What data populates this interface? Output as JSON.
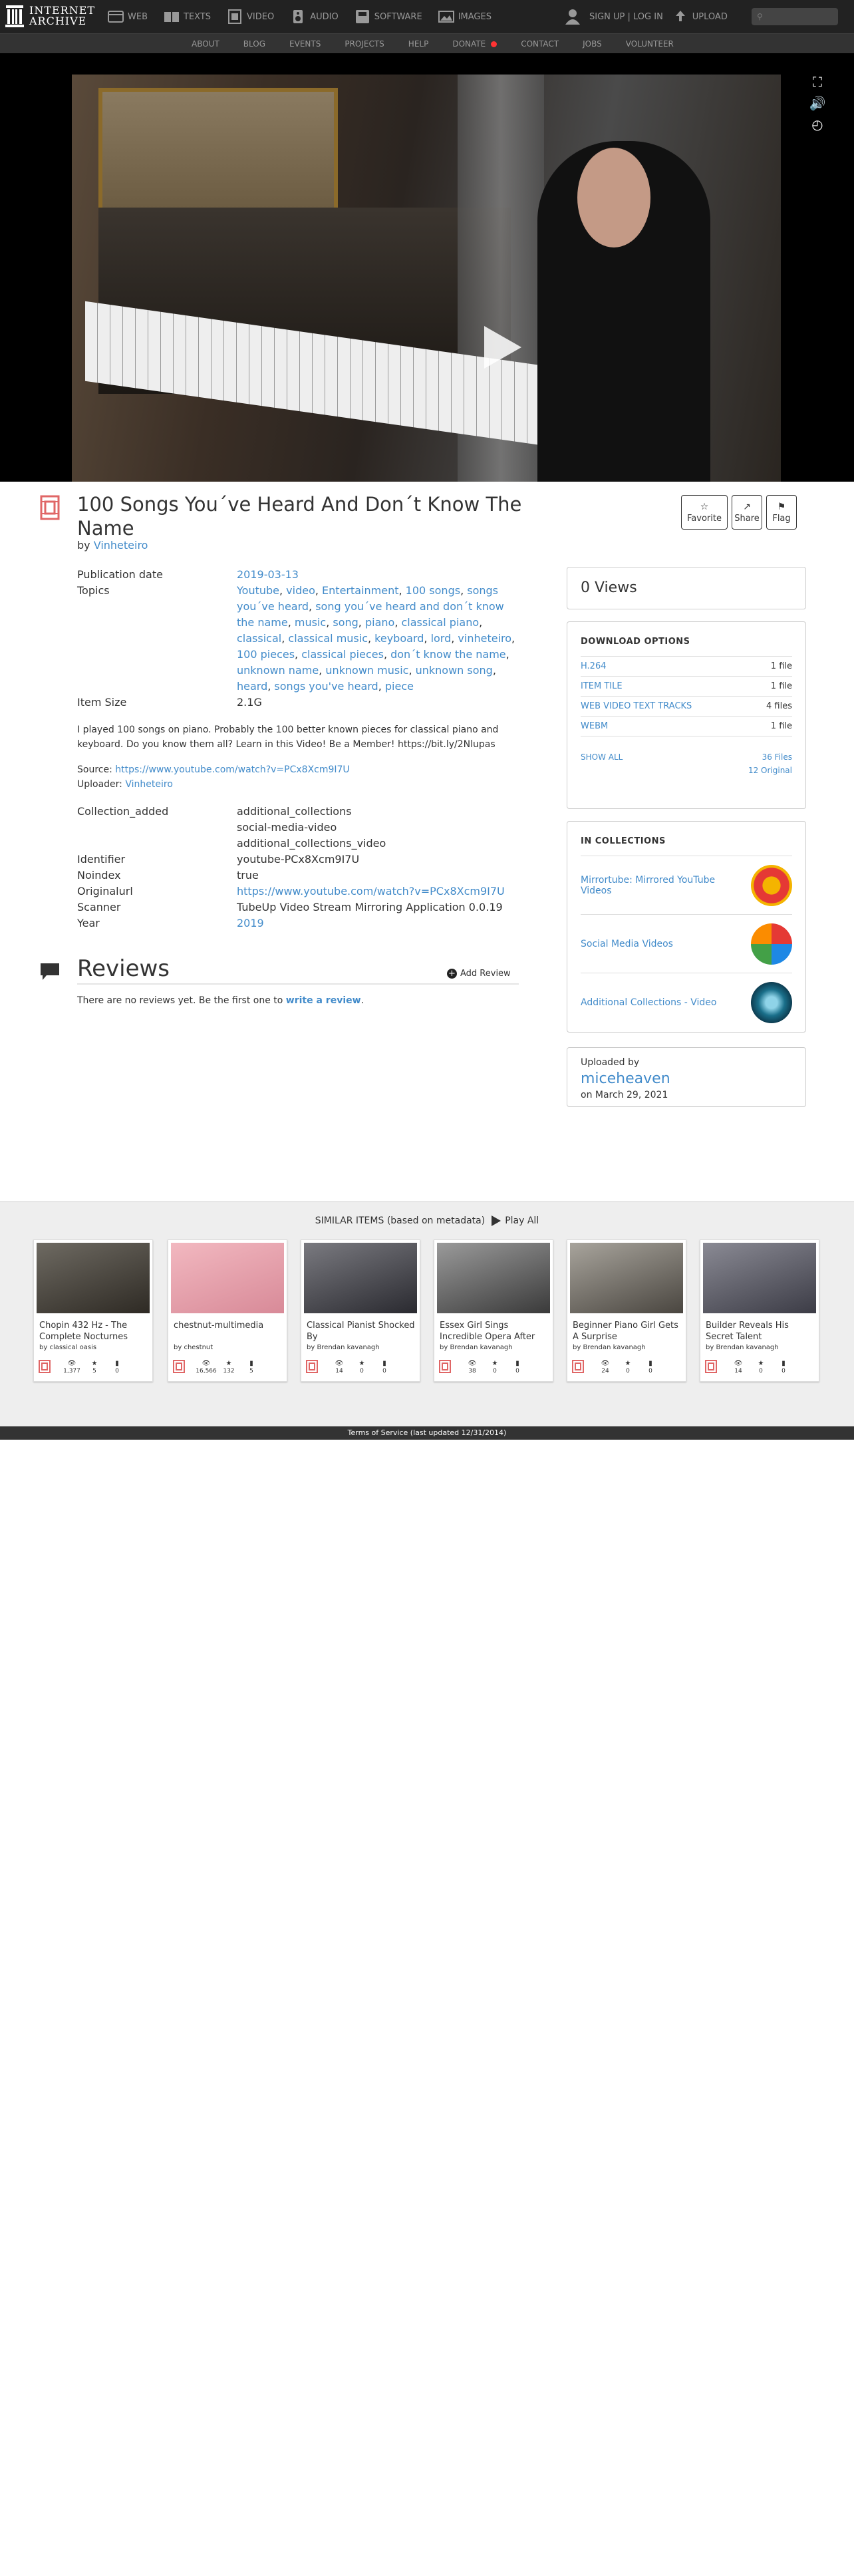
{
  "topnav": {
    "logo_line1": "INTERNET",
    "logo_line2": "ARCHIVE",
    "media": [
      {
        "label": "WEB",
        "icon": "web-icon"
      },
      {
        "label": "TEXTS",
        "icon": "texts-icon"
      },
      {
        "label": "VIDEO",
        "icon": "video-icon"
      },
      {
        "label": "AUDIO",
        "icon": "audio-icon"
      },
      {
        "label": "SOFTWARE",
        "icon": "software-icon"
      },
      {
        "label": "IMAGES",
        "icon": "images-icon"
      }
    ],
    "signup": "SIGN UP | LOG IN",
    "upload": "UPLOAD",
    "search_placeholder": ""
  },
  "subnav": [
    "ABOUT",
    "BLOG",
    "EVENTS",
    "PROJECTS",
    "HELP",
    "DONATE",
    "CONTACT",
    "JOBS",
    "VOLUNTEER"
  ],
  "item": {
    "title": "100 Songs You´ve Heard And Don´t Know The Name",
    "by_prefix": "by",
    "creator": "Vinheteiro",
    "buttons": {
      "favorite": "Favorite",
      "share": "Share",
      "flag": "Flag"
    }
  },
  "metadata": {
    "pub_date_label": "Publication date",
    "pub_date": "2019-03-13",
    "topics_label": "Topics",
    "topics": [
      "Youtube",
      "video",
      "Entertainment",
      "100 songs",
      "songs you´ve heard",
      "song you´ve heard and don´t know the name",
      "music",
      "song",
      "piano",
      "classical piano",
      "classical",
      "classical music",
      "keyboard",
      "lord",
      "vinheteiro",
      "100 pieces",
      "classical pieces",
      "don´t know the name",
      "unknown name",
      "unknown music",
      "unknown song",
      "heard",
      "songs you've heard",
      "piece"
    ],
    "item_size_label": "Item Size",
    "item_size": "2.1G",
    "description": "I played 100 songs on piano. Probably the 100 better known pieces for classical piano and keyboard. Do you know them all? Learn in this Video! Be a Member! https://bit.ly/2Nlupas",
    "source_label": "Source:",
    "source_url": "https://www.youtube.com/watch?v=PCx8Xcm9I7U",
    "uploader_label": "Uploader:",
    "uploader": "Vinheteiro",
    "collection_added_label": "Collection_added",
    "collection_added": [
      "additional_collections",
      "social-media-video",
      "additional_collections_video"
    ],
    "identifier_label": "Identifier",
    "identifier": "youtube-PCx8Xcm9I7U",
    "noindex_label": "Noindex",
    "noindex": "true",
    "originalurl_label": "Originalurl",
    "originalurl": "https://www.youtube.com/watch?v=PCx8Xcm9I7U",
    "scanner_label": "Scanner",
    "scanner": "TubeUp Video Stream Mirroring Application 0.0.19",
    "year_label": "Year",
    "year": "2019"
  },
  "reviews": {
    "heading": "Reviews",
    "add_review": "Add Review",
    "none_text": "There are no reviews yet. Be the first one to",
    "write_link": "write a review",
    "period": "."
  },
  "sidebar": {
    "views": "0 Views",
    "download_heading": "DOWNLOAD OPTIONS",
    "downloads": [
      {
        "format": "H.264",
        "count": "1 file"
      },
      {
        "format": "ITEM TILE",
        "count": "1 file"
      },
      {
        "format": "WEB VIDEO TEXT TRACKS",
        "count": "4 files"
      },
      {
        "format": "WEBM",
        "count": "1 file"
      }
    ],
    "show_all": "SHOW ALL",
    "files_count": "36 Files",
    "original_count": "12 Original",
    "collections_heading": "IN COLLECTIONS",
    "collections": [
      "Mirrortube: Mirrored YouTube Videos",
      "Social Media Videos",
      "Additional Collections - Video"
    ],
    "uploaded_by_label": "Uploaded by",
    "uploader_name": "miceheaven",
    "upload_date": "on March 29, 2021"
  },
  "similar": {
    "heading": "SIMILAR ITEMS (based on metadata)",
    "play_all": "Play All",
    "tiles": [
      {
        "title": "Chopin 432 Hz - The Complete Nocturnes",
        "by": "by classical oasis",
        "views": "1,377",
        "favs": "5",
        "reviews": "0",
        "color1": "#6e6a62",
        "color2": "#2e2a24"
      },
      {
        "title": "chestnut-multimedia",
        "by": "by chestnut",
        "views": "16,566",
        "favs": "132",
        "reviews": "5",
        "color1": "#f2b8c0",
        "color2": "#d88a98"
      },
      {
        "title": "Classical Pianist Shocked By",
        "by": "by Brendan kavanagh",
        "views": "14",
        "favs": "0",
        "reviews": "0",
        "color1": "#7a7a80",
        "color2": "#2a2a30"
      },
      {
        "title": "Essex Girl Sings Incredible Opera After",
        "by": "by Brendan kavanagh",
        "views": "38",
        "favs": "0",
        "reviews": "0",
        "color1": "#9a9a9a",
        "color2": "#3a3a3a"
      },
      {
        "title": "Beginner Piano Girl Gets A Surprise",
        "by": "by Brendan kavanagh",
        "views": "24",
        "favs": "0",
        "reviews": "0",
        "color1": "#a8a49c",
        "color2": "#4a4640"
      },
      {
        "title": "Builder Reveals His Secret Talent",
        "by": "by Brendan kavanagh",
        "views": "14",
        "favs": "0",
        "reviews": "0",
        "color1": "#8a8a94",
        "color2": "#3c3c46"
      }
    ]
  },
  "footer": "Terms of Service (last updated 12/31/2014)",
  "colors": {
    "accent": "#428bca",
    "movie_icon": "#e06666",
    "nav_bg": "#222222"
  }
}
